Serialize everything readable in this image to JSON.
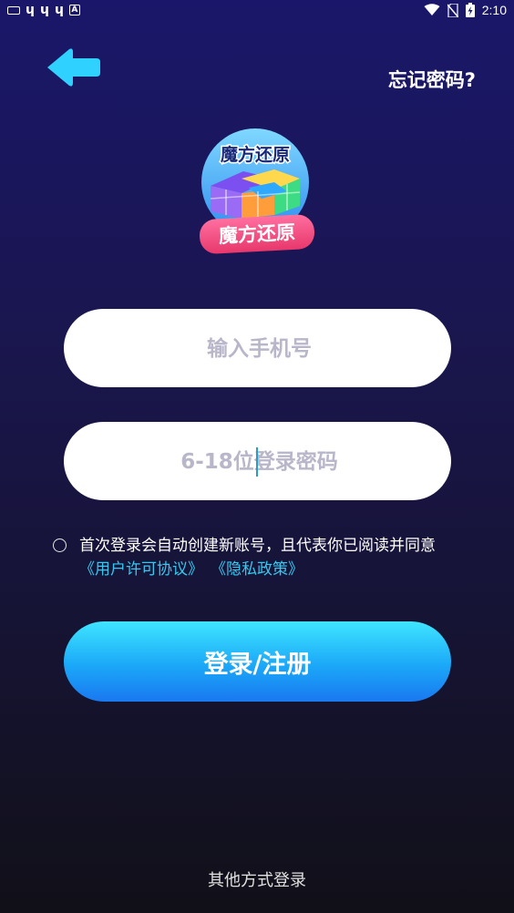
{
  "status_bar": {
    "time": "2:10",
    "left_icons": [
      "keyboard-icon",
      "app-icon",
      "app-icon",
      "app-icon",
      "a-box-icon"
    ],
    "app_glyph": "ɥ",
    "a_glyph": "A",
    "right_icons": [
      "wifi-icon",
      "no-sim-icon",
      "battery-charging-icon"
    ]
  },
  "header": {
    "back_icon": "back-arrow-icon",
    "back_color": "#2fd1ff",
    "forgot_label": "忘记密码?"
  },
  "logo": {
    "top_text": "魔方还原",
    "badge_text": "魔方还原"
  },
  "form": {
    "phone_placeholder": "输入手机号",
    "password_placeholder": "6-18位登录密码",
    "agreement_text": "首次登录会自动创建新账号，且代表你已阅读并同意",
    "user_agreement_link": "《用户许可协议》",
    "privacy_link": "《隐私政策》",
    "submit_label": "登录/注册"
  },
  "footer": {
    "other_login_label": "其他方式登录"
  },
  "colors": {
    "accent": "#35c9f0",
    "button_top": "#3fe5ff",
    "button_bottom": "#1a78f0"
  }
}
